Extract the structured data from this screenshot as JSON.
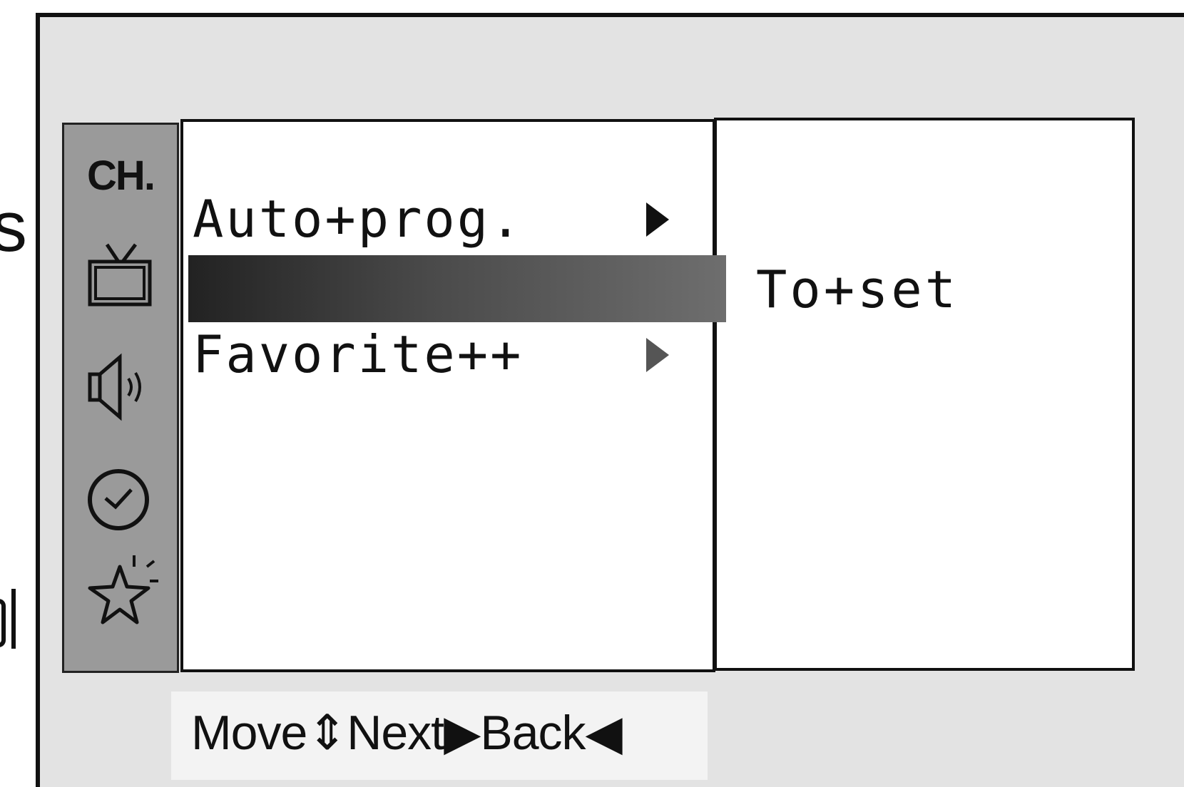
{
  "edge_fragment": {
    "s": "s"
  },
  "sidebar": {
    "title": "CH.",
    "icons": [
      "tv-icon",
      "speaker-icon",
      "clock-icon",
      "star-icon"
    ]
  },
  "menu": {
    "items": [
      {
        "label": "Auto+prog.",
        "has_submenu": true
      },
      {
        "label": "",
        "selected": true
      },
      {
        "label": "Favorite++",
        "has_submenu": true
      }
    ]
  },
  "submenu": {
    "value": "To+set"
  },
  "help": {
    "text": "Move⇕Next▶Back◀"
  },
  "colors": {
    "selection": "#333333",
    "sidebar": "#9a9a9a",
    "panel": "#ffffff",
    "background": "#e3e3e3"
  }
}
